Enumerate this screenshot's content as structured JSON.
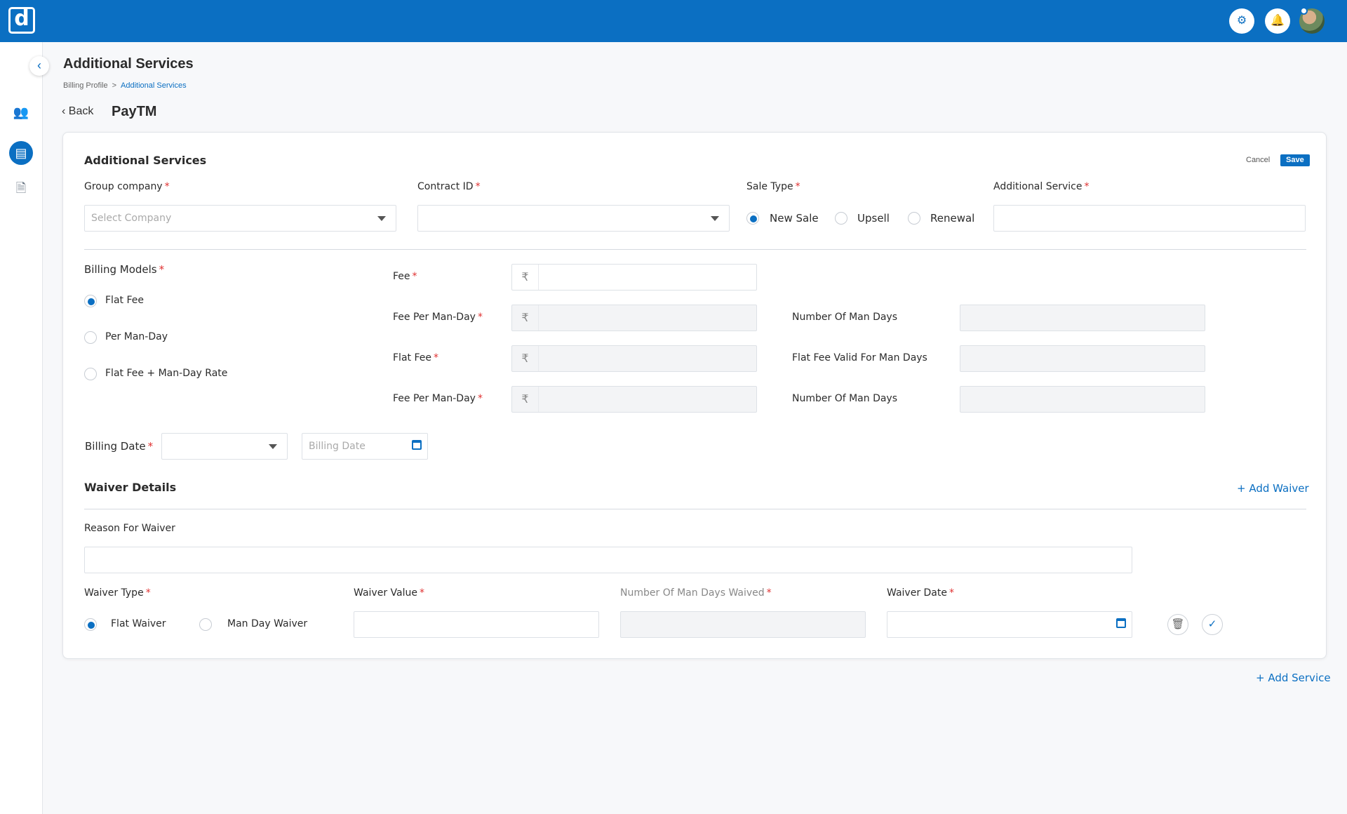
{
  "topbar": {
    "logo_text": "d",
    "icons": [
      "settings-icon",
      "notification-bell-icon"
    ]
  },
  "sidebar": {
    "icons": [
      "team-icon",
      "billing-icon",
      "documents-icon"
    ]
  },
  "page": {
    "title": "Additional Services"
  },
  "breadcrumb": {
    "items": [
      "Billing Profile",
      "Additional Services"
    ],
    "separator": ">"
  },
  "header": {
    "back_label": "Back",
    "company_name": "PayTM"
  },
  "form": {
    "section_title": "Additional Services",
    "cancel_label": "Cancel",
    "save_label": "Save",
    "group_company": {
      "label": "Group company",
      "placeholder": "Select Company"
    },
    "contract_id": {
      "label": "Contract ID",
      "value": ""
    },
    "sale_type": {
      "label": "Sale Type",
      "options": [
        "New Sale",
        "Upsell",
        "Renewal"
      ],
      "selected": "New Sale"
    },
    "additional_service": {
      "label": "Additional Service",
      "value": ""
    },
    "billing_models": {
      "label": "Billing Models",
      "options": [
        "Flat Fee",
        "Per Man-Day",
        "Flat Fee + Man-Day Rate"
      ],
      "selected": "Flat Fee"
    },
    "currency_symbol": "₹",
    "fee_label": "Fee",
    "fee_per_man_day_label": "Fee Per Man-Day",
    "flat_fee_label": "Flat Fee",
    "number_of_man_days_label": "Number Of Man Days",
    "flat_fee_valid_label": "Flat Fee Valid For Man Days",
    "billing_date": {
      "label": "Billing Date",
      "placeholder": "Billing  Date"
    }
  },
  "waiver": {
    "title": "Waiver Details",
    "add_label": "+ Add Waiver",
    "reason_label": "Reason For Waiver",
    "type": {
      "label": "Waiver Type",
      "options": [
        "Flat Waiver",
        "Man Day Waiver"
      ],
      "selected": "Flat Waiver"
    },
    "value_label": "Waiver Value",
    "man_days_label": "Number Of Man Days Waived",
    "date_label": "Waiver Date"
  },
  "add_service_label": "+ Add Service",
  "colors": {
    "primary": "#0b6fc2",
    "required": "#e03131"
  }
}
